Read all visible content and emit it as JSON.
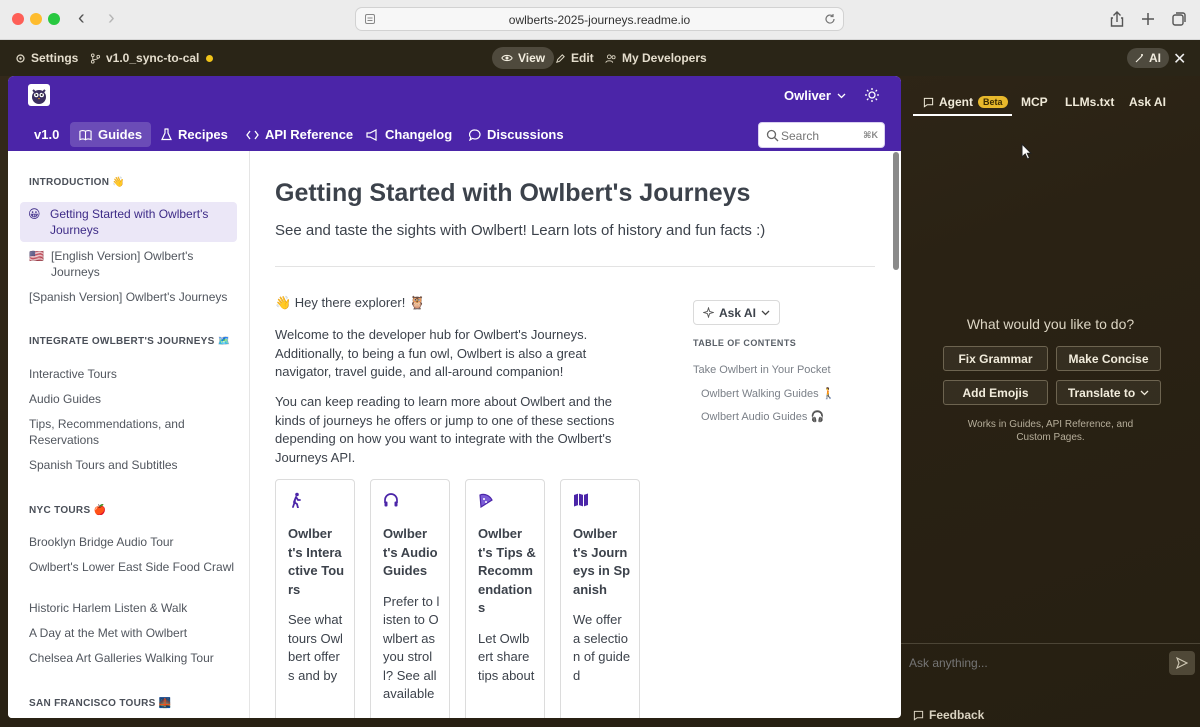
{
  "browser": {
    "url": "owlberts-2025-journeys.readme.io"
  },
  "editor_bar": {
    "settings_label": "Settings",
    "branch_label": "v1.0_sync-to-cal",
    "view_label": "View",
    "edit_label": "Edit",
    "developers_label": "My Developers",
    "ai_label": "AI"
  },
  "header": {
    "user_label": "Owliver",
    "nav": [
      {
        "label": "v1.0"
      },
      {
        "label": "Guides"
      },
      {
        "label": "Recipes"
      },
      {
        "label": "API Reference"
      },
      {
        "label": "Changelog"
      },
      {
        "label": "Discussions"
      }
    ],
    "search_placeholder": "Search",
    "search_shortcut": "⌘K"
  },
  "sidebar": {
    "sections": [
      {
        "title": "INTRODUCTION 👋"
      },
      {
        "title": "INTEGRATE OWLBERT'S JOURNEYS 🗺️"
      },
      {
        "title": "NYC TOURS 🍎"
      },
      {
        "title": "SAN FRANCISCO TOURS 🌉"
      }
    ],
    "intro_items": [
      {
        "emoji": "😀",
        "label": "Getting Started with Owlbert's Journeys"
      },
      {
        "emoji": "🇺🇸",
        "label": "[English Version] Owlbert's Journeys"
      },
      {
        "emoji": "",
        "label": "[Spanish Version] Owlbert's Journeys"
      }
    ],
    "integrate_items": [
      {
        "label": "Interactive Tours"
      },
      {
        "label": "Audio Guides"
      },
      {
        "label": "Tips, Recommendations, and Reservations"
      },
      {
        "label": "Spanish Tours and Subtitles"
      }
    ],
    "nyc_items": [
      {
        "label": "Brooklyn Bridge Audio Tour"
      },
      {
        "label": "Owlbert's Lower East Side Food Crawl"
      },
      {
        "label": "Historic Harlem Listen & Walk"
      },
      {
        "label": "A Day at the Met with Owlbert"
      },
      {
        "label": "Chelsea Art Galleries Walking Tour"
      }
    ]
  },
  "content": {
    "title": "Getting Started with Owlbert's Journeys",
    "subtitle": "See and taste the sights with Owlbert! Learn lots of history and fun facts :)",
    "greeting": "👋 Hey there explorer! 🦉",
    "para1": "Welcome to the developer hub for Owlbert's Journeys. Additionally, to being a fun owl, Owlbert is also a great navigator, travel guide, and all-around companion!",
    "para2": "You can keep reading to learn more about Owlbert and the kinds of journeys he offers or jump to one of these sections depending on how you want to integrate with the Owlbert's Journeys API.",
    "cards": [
      {
        "icon": "walking-person-icon",
        "title": "Owlbert's Interactive Tours",
        "body": "See what tours Owlbert offers and by"
      },
      {
        "icon": "headphones-icon",
        "title": "Owlbert's Audio Guides",
        "body": "Prefer to listen to Owlbert as you stroll? See all available"
      },
      {
        "icon": "pizza-icon",
        "title": "Owlbert's Tips & Recommendations",
        "body": "Let Owlbert share tips about"
      },
      {
        "icon": "map-icon",
        "title": "Owlbert's Journeys in Spanish",
        "body": "We offer a selection of guided"
      }
    ]
  },
  "toc": {
    "ask_ai_label": "Ask AI",
    "heading": "TABLE OF CONTENTS",
    "items": [
      {
        "label": "Take Owlbert in Your Pocket"
      },
      {
        "label": "Owlbert Walking Guides 🚶"
      },
      {
        "label": "Owlbert Audio Guides 🎧"
      }
    ]
  },
  "ai_panel": {
    "tabs": [
      {
        "label": "Agent"
      },
      {
        "label": "MCP"
      },
      {
        "label": "LLMs.txt"
      },
      {
        "label": "Ask AI"
      }
    ],
    "beta_badge": "Beta",
    "question": "What would you like to do?",
    "actions": [
      {
        "label": "Fix Grammar"
      },
      {
        "label": "Make Concise"
      },
      {
        "label": "Add Emojis"
      },
      {
        "label": "Translate to"
      }
    ],
    "note": "Works in Guides, API Reference, and Custom Pages.",
    "input_placeholder": "Ask anything...",
    "feedback_label": "Feedback"
  },
  "colors": {
    "header_purple": "#4b25a8",
    "beta_yellow": "#e8b92c",
    "branch_dot": "#f0c419"
  }
}
